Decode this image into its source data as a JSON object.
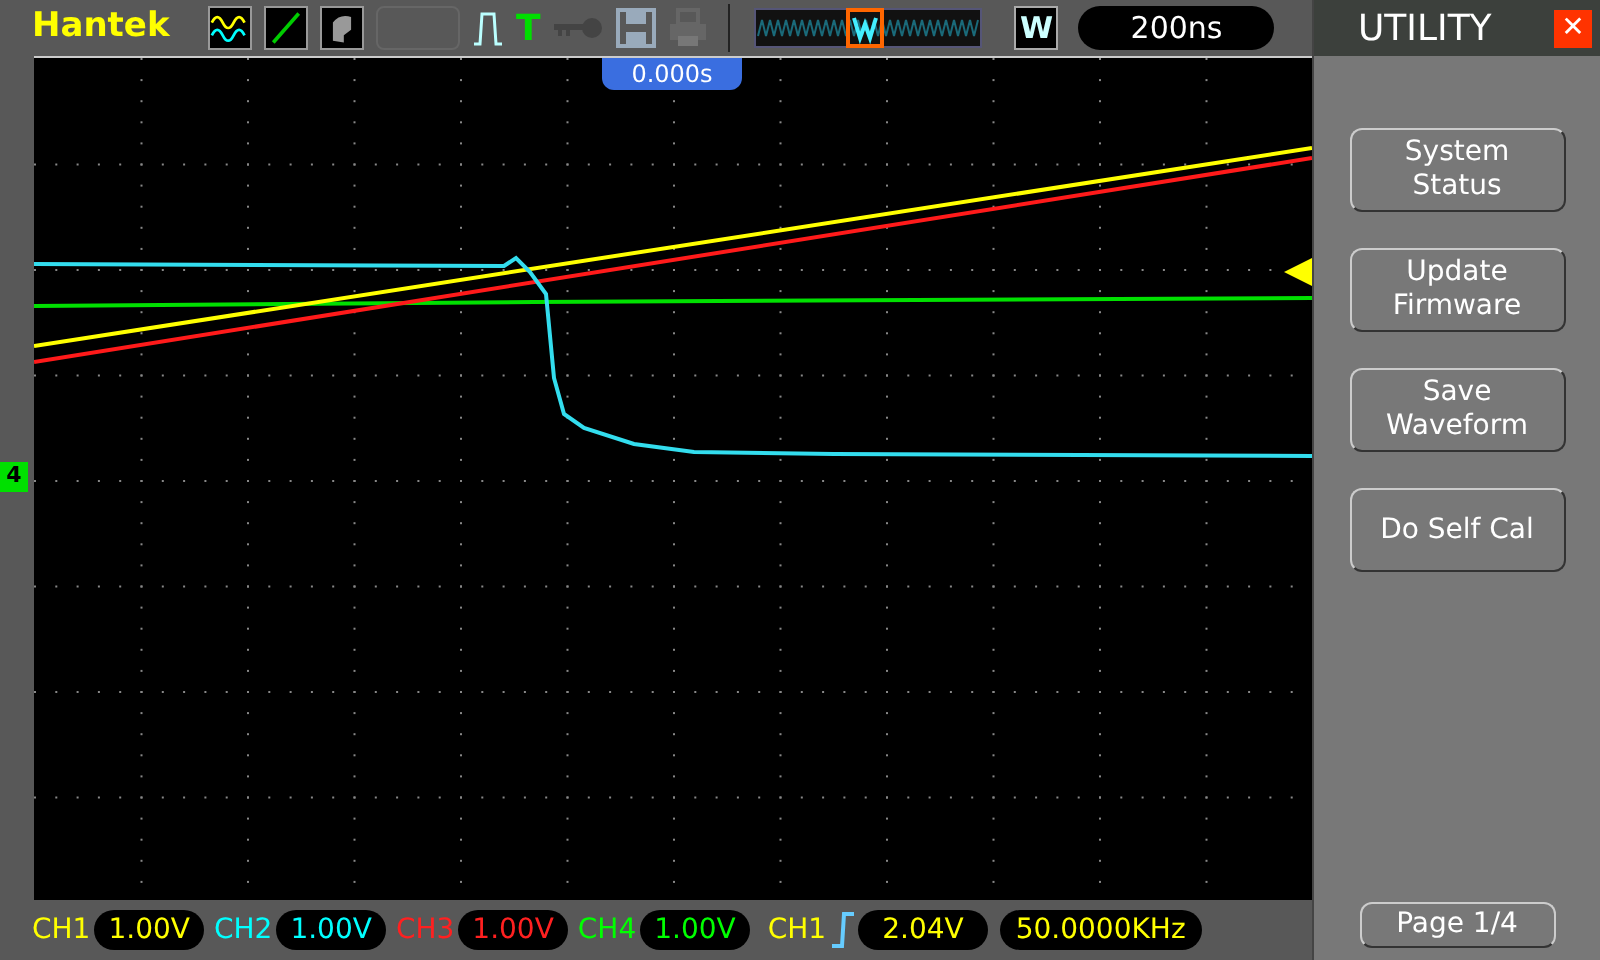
{
  "top_bar": {
    "brand": "Hantek",
    "trigger_letter": "T",
    "window_mode": "W",
    "timebase": "200ns"
  },
  "screen": {
    "trigger_time": "0.000s",
    "ground_marker": "4"
  },
  "menu": {
    "title": "UTILITY",
    "close": "✕",
    "buttons": [
      {
        "label": "System Status"
      },
      {
        "label": "Update Firmware"
      },
      {
        "label": "Save Waveform"
      },
      {
        "label": "Do Self Cal"
      }
    ],
    "page": "Page 1/4"
  },
  "channels": [
    {
      "label": "CH1",
      "scale": "1.00V",
      "color": "#ffff00"
    },
    {
      "label": "CH2",
      "scale": "1.00V",
      "color": "#00ffff"
    },
    {
      "label": "CH3",
      "scale": "1.00V",
      "color": "#ff2020"
    },
    {
      "label": "CH4",
      "scale": "1.00V",
      "color": "#00ff00"
    }
  ],
  "trigger": {
    "source": "CH1",
    "level": "2.04V",
    "frequency": "50.0000KHz"
  }
}
